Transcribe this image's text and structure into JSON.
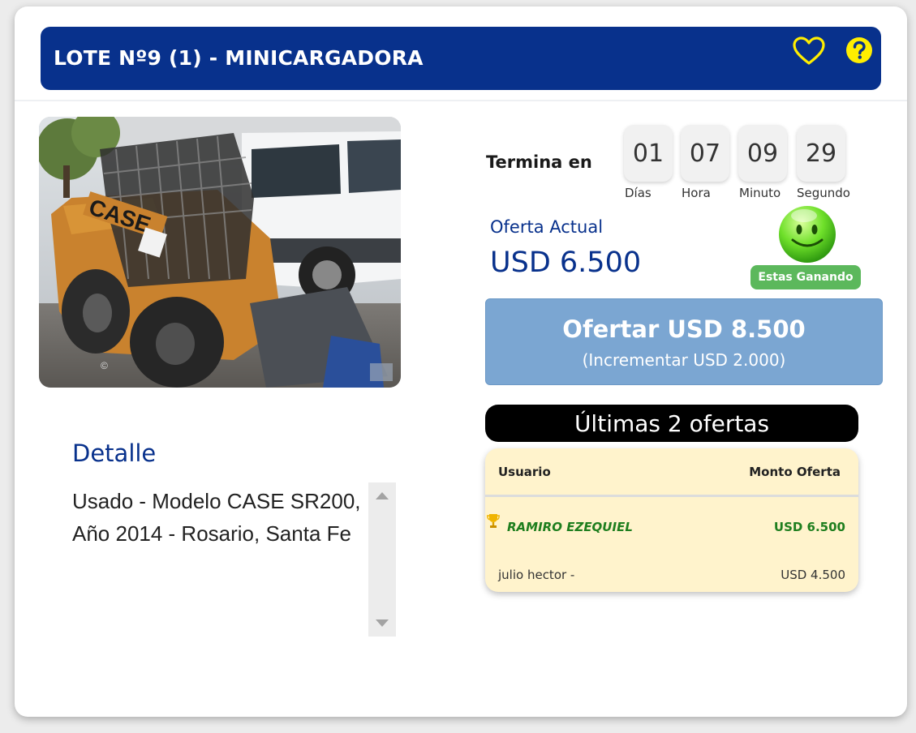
{
  "header": {
    "title": "LOTE Nº9 (1) - MINICARGADORA",
    "favorite_icon": "heart-icon",
    "help_icon": "question-circle-icon",
    "accent_color": "#08318c",
    "icon_color": "#ffee00"
  },
  "photo": {
    "copyright": "©"
  },
  "detail": {
    "title": "Detalle",
    "text": "Usado - Modelo CASE SR200, Año 2014 - Rosario, Santa Fe"
  },
  "countdown": {
    "label": "Termina en",
    "units": [
      {
        "value": "01",
        "label": "Días"
      },
      {
        "value": "07",
        "label": "Hora"
      },
      {
        "value": "09",
        "label": "Minuto"
      },
      {
        "value": "29",
        "label": "Segundo"
      }
    ]
  },
  "current_offer": {
    "label": "Oferta Actual",
    "value": "USD 6.500",
    "status_icon": "smiley-icon",
    "status_badge": "Estas Ganando",
    "status_color": "#5cb85c"
  },
  "bid_button": {
    "label": "Ofertar USD 8.500",
    "sub_label": "(Incrementar USD 2.000)",
    "color": "#7ba6d2"
  },
  "last_bids": {
    "title": "Últimas 2 ofertas",
    "columns": [
      "Usuario",
      "Monto Oferta"
    ],
    "rows": [
      {
        "user": "RAMIRO EZEQUIEL",
        "amount": "USD 6.500",
        "icon": "trophy-icon"
      },
      {
        "user": "julio hector -",
        "amount": "USD 4.500"
      }
    ]
  }
}
